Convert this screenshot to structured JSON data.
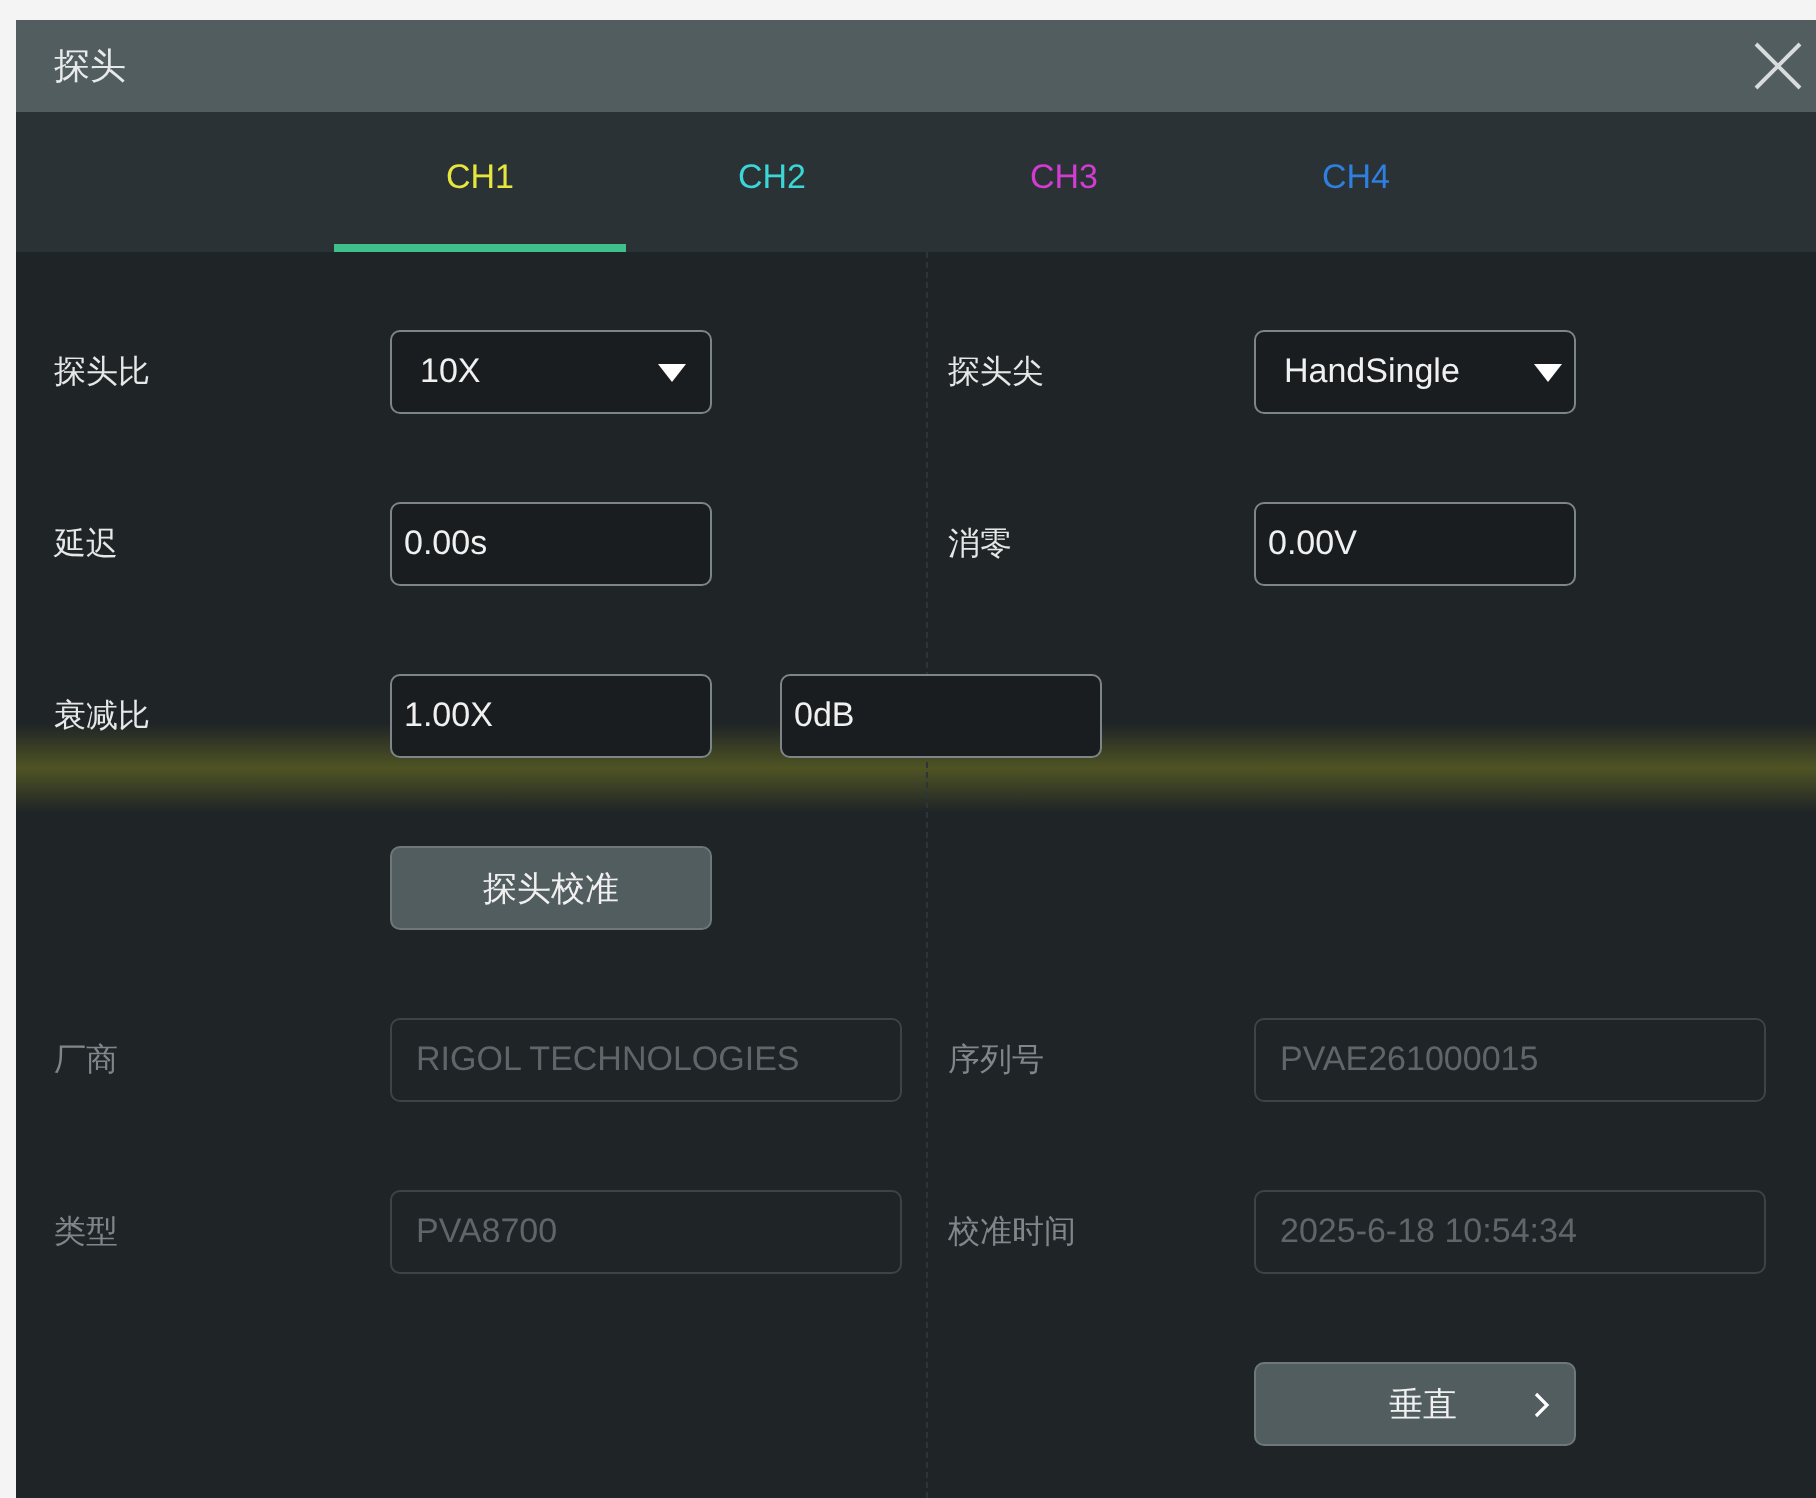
{
  "dialog": {
    "title": "探头"
  },
  "tabs": [
    {
      "label": "CH1",
      "color": "#e6e63c",
      "selected": true
    },
    {
      "label": "CH2",
      "color": "#3cd6d6",
      "selected": false
    },
    {
      "label": "CH3",
      "color": "#d23cd2",
      "selected": false
    },
    {
      "label": "CH4",
      "color": "#2f7fe0",
      "selected": false
    }
  ],
  "rows": [
    {
      "left": {
        "label": "探头比",
        "disabled": false,
        "controls": [
          {
            "kind": "dropdown",
            "value": "10X"
          }
        ]
      },
      "right": {
        "label": "探头尖",
        "disabled": false,
        "controls": [
          {
            "kind": "dropdown",
            "value": "HandSingle"
          }
        ]
      }
    },
    {
      "left": {
        "label": "延迟",
        "disabled": false,
        "controls": [
          {
            "kind": "input",
            "value": "0.00s",
            "disabled": false
          }
        ]
      },
      "right": {
        "label": "消零",
        "disabled": false,
        "controls": [
          {
            "kind": "input",
            "value": "0.00V",
            "disabled": false
          }
        ]
      }
    },
    {
      "left": {
        "label": "衰减比",
        "disabled": false,
        "controls": [
          {
            "kind": "input",
            "value": "1.00X",
            "disabled": false
          },
          {
            "kind": "input",
            "value": "0dB",
            "disabled": false
          }
        ]
      }
    },
    {
      "left": {
        "controls": [
          {
            "kind": "button",
            "value": "探头校准"
          }
        ]
      }
    },
    {
      "left": {
        "label": "厂商",
        "disabled": true,
        "controls": [
          {
            "kind": "input",
            "value": "RIGOL TECHNOLOGIES",
            "disabled": true
          }
        ]
      },
      "right": {
        "label": "序列号",
        "disabled": true,
        "controls": [
          {
            "kind": "input",
            "value": "PVAE261000015",
            "disabled": true
          }
        ]
      }
    },
    {
      "left": {
        "label": "类型",
        "disabled": true,
        "controls": [
          {
            "kind": "input",
            "value": "PVA8700",
            "disabled": true
          }
        ]
      },
      "right": {
        "label": "校准时间",
        "disabled": true,
        "controls": [
          {
            "kind": "input",
            "value": "2025-6-18 10:54:34",
            "disabled": true
          }
        ]
      }
    },
    {
      "right": {
        "controls": [
          {
            "kind": "nav_button",
            "value": "垂直"
          }
        ]
      }
    }
  ]
}
